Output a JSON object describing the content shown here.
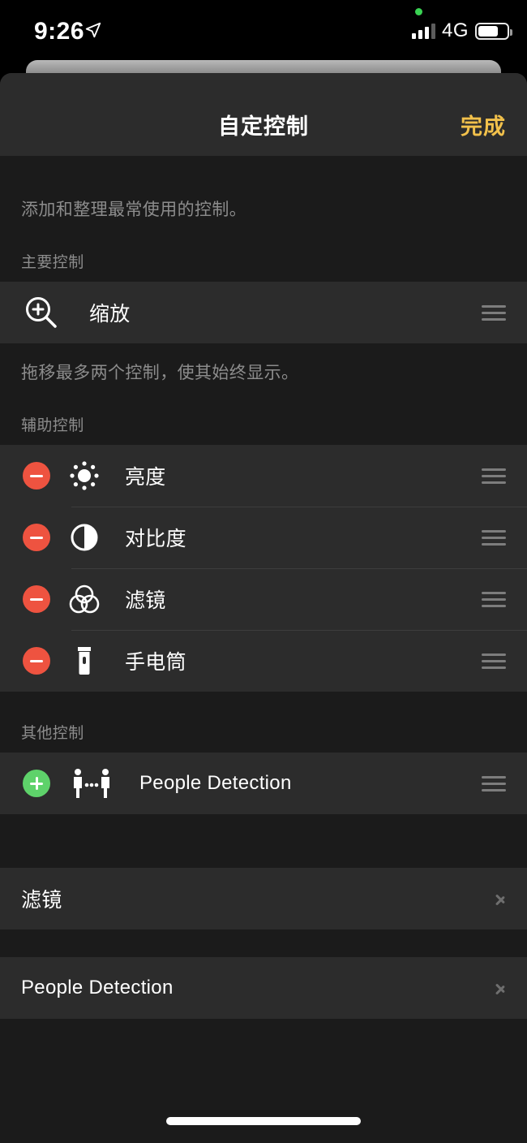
{
  "status_bar": {
    "time": "9:26",
    "location_icon": "location-arrow-icon",
    "recording_dot": "green-privacy-dot",
    "network": "4G",
    "signal_bars": 3,
    "battery_level": "72%"
  },
  "nav": {
    "title": "自定控制",
    "done_label": "完成",
    "done_color": "#f2c14b"
  },
  "blurb": "添加和整理最常使用的控制。",
  "sections": [
    {
      "header": "主要控制",
      "footer": "拖移最多两个控制，使其始终显示。",
      "rows": [
        {
          "icon": "zoom-in-magnifier-icon",
          "label": "缩放",
          "badge": "none",
          "accessory": "drag-handle"
        }
      ]
    },
    {
      "header": "辅助控制",
      "rows": [
        {
          "icon": "brightness-sun-icon",
          "label": "亮度",
          "badge": "remove",
          "accessory": "drag-handle"
        },
        {
          "icon": "contrast-circle-icon",
          "label": "对比度",
          "badge": "remove",
          "accessory": "drag-handle"
        },
        {
          "icon": "color-filters-icon",
          "label": "滤镜",
          "badge": "remove",
          "accessory": "drag-handle"
        },
        {
          "icon": "flashlight-icon",
          "label": "手电筒",
          "badge": "remove",
          "accessory": "drag-handle"
        }
      ]
    },
    {
      "header": "其他控制",
      "rows": [
        {
          "icon": "people-detection-icon",
          "label": "People Detection",
          "badge": "add",
          "accessory": "drag-handle"
        }
      ]
    }
  ],
  "detail_rows": [
    {
      "label": "滤镜",
      "accessory": "chevron-right"
    },
    {
      "label": "People Detection",
      "accessory": "chevron-right"
    }
  ],
  "colors": {
    "page_background": "#1b1b1b",
    "row_background": "#2c2c2c",
    "accent_done": "#f2c14b",
    "badge_remove": "#ee5340",
    "badge_add": "#5ed26a",
    "secondary_text": "#8c8c8c"
  }
}
